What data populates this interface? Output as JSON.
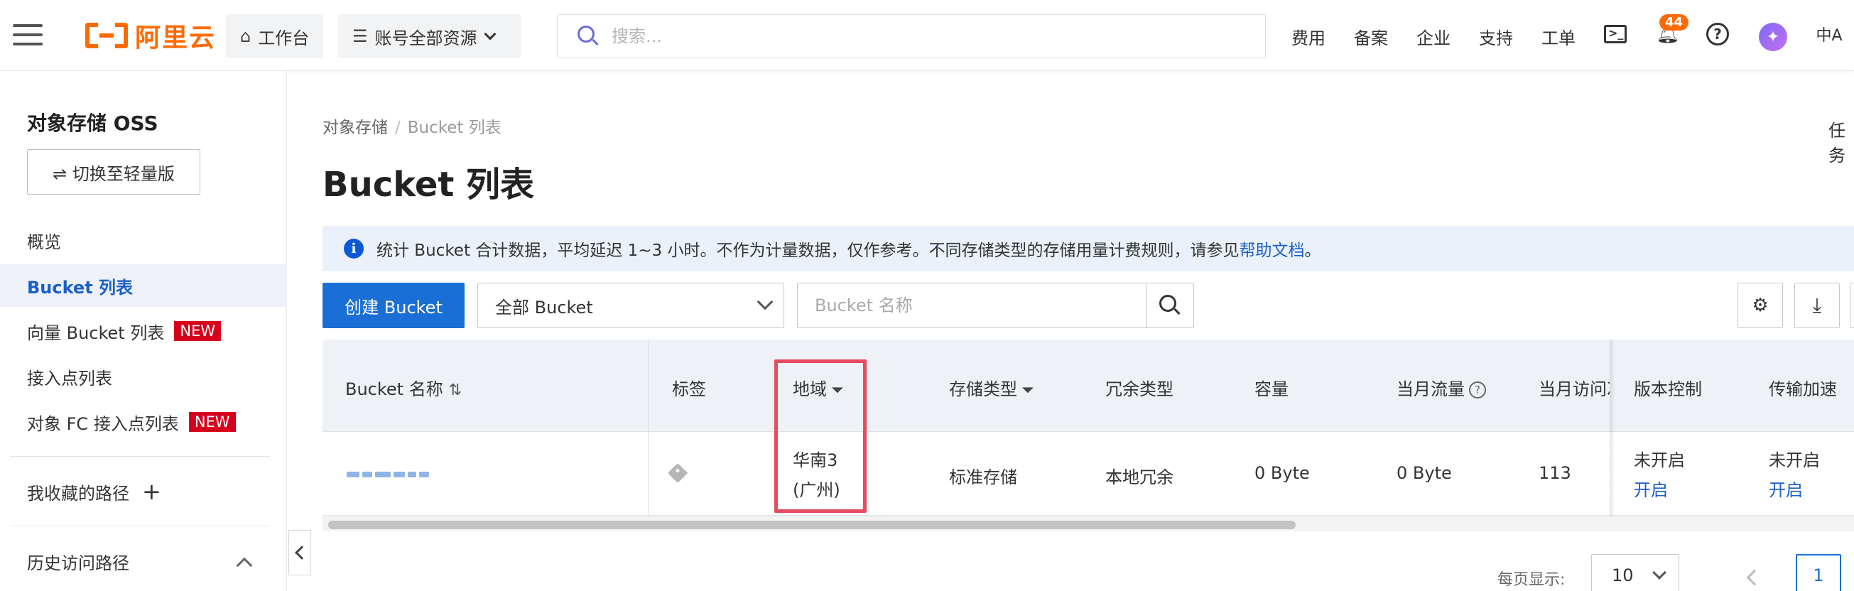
{
  "topbar": {
    "brand": "阿里云",
    "workbench": "工作台",
    "resources": "账号全部资源",
    "search_placeholder": "搜索...",
    "nav": [
      "费用",
      "备案",
      "企业",
      "支持",
      "工单"
    ],
    "notification_count": "44",
    "lang_icon": "中A",
    "help_icon": "?"
  },
  "sidebar": {
    "title": "对象存储 OSS",
    "switch_label": "⇌ 切换至轻量版",
    "items": [
      {
        "label": "概览"
      },
      {
        "label": "Bucket 列表"
      },
      {
        "label": "向量 Bucket 列表",
        "tag": "NEW"
      },
      {
        "label": "接入点列表"
      },
      {
        "label": "对象 FC 接入点列表",
        "tag": "NEW"
      }
    ],
    "favorites": "我收藏的路径",
    "history": "历史访问路径"
  },
  "breadcrumb": {
    "root": "对象存储",
    "sep": "/",
    "current": "Bucket 列表"
  },
  "right_cut_text": "任务",
  "page_title": "Bucket 列表",
  "notice": {
    "text": "统计 Bucket 合计数据，平均延迟 1~3 小时。不作为计量数据，仅作参考。不同存储类型的存储用量计费规则，请参见",
    "link": "帮助文档",
    "end": "。"
  },
  "toolbar": {
    "create_label": "创建 Bucket",
    "filter_value": "全部 Bucket",
    "search_placeholder": "Bucket 名称"
  },
  "table": {
    "headers": {
      "name": "Bucket 名称",
      "tags": "标签",
      "region": "地域",
      "storage_class": "存储类型",
      "redundancy": "冗余类型",
      "capacity": "容量",
      "traffic": "当月流量",
      "requests": "当月访问次数",
      "versioning": "版本控制",
      "acceleration": "传输加速"
    },
    "rows": [
      {
        "region_line1": "华南3",
        "region_line2": "(广州)",
        "storage_class": "标准存储",
        "redundancy": "本地冗余",
        "capacity": "0 Byte",
        "traffic": "0 Byte",
        "requests": "113",
        "versioning_status": "未开启",
        "versioning_action": "开启",
        "acceleration_status": "未开启",
        "acceleration_action": "开启"
      }
    ]
  },
  "pagination": {
    "label": "每页显示:",
    "page_size": "10",
    "current_page": "1"
  },
  "colors": {
    "brand": "#ff6a00",
    "primary": "#1a6fd6",
    "highlight": "#e84a5f",
    "new_tag": "#d6001c"
  }
}
